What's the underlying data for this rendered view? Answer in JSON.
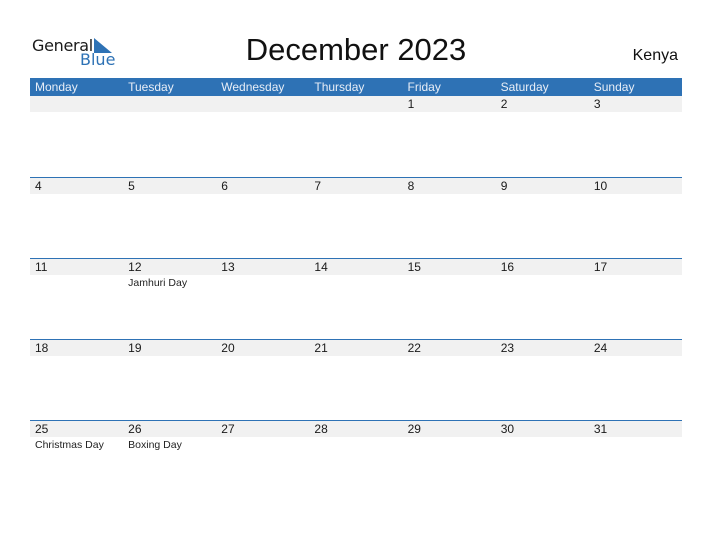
{
  "logo": {
    "general": "General",
    "blue": "Blue"
  },
  "title": "December 2023",
  "country": "Kenya",
  "colors": {
    "accent": "#2e72b5",
    "band": "#f1f1f1"
  },
  "days_of_week": [
    "Monday",
    "Tuesday",
    "Wednesday",
    "Thursday",
    "Friday",
    "Saturday",
    "Sunday"
  ],
  "weeks": [
    [
      {
        "day": "",
        "holiday": ""
      },
      {
        "day": "",
        "holiday": ""
      },
      {
        "day": "",
        "holiday": ""
      },
      {
        "day": "",
        "holiday": ""
      },
      {
        "day": "1",
        "holiday": ""
      },
      {
        "day": "2",
        "holiday": ""
      },
      {
        "day": "3",
        "holiday": ""
      }
    ],
    [
      {
        "day": "4",
        "holiday": ""
      },
      {
        "day": "5",
        "holiday": ""
      },
      {
        "day": "6",
        "holiday": ""
      },
      {
        "day": "7",
        "holiday": ""
      },
      {
        "day": "8",
        "holiday": ""
      },
      {
        "day": "9",
        "holiday": ""
      },
      {
        "day": "10",
        "holiday": ""
      }
    ],
    [
      {
        "day": "11",
        "holiday": ""
      },
      {
        "day": "12",
        "holiday": "Jamhuri Day"
      },
      {
        "day": "13",
        "holiday": ""
      },
      {
        "day": "14",
        "holiday": ""
      },
      {
        "day": "15",
        "holiday": ""
      },
      {
        "day": "16",
        "holiday": ""
      },
      {
        "day": "17",
        "holiday": ""
      }
    ],
    [
      {
        "day": "18",
        "holiday": ""
      },
      {
        "day": "19",
        "holiday": ""
      },
      {
        "day": "20",
        "holiday": ""
      },
      {
        "day": "21",
        "holiday": ""
      },
      {
        "day": "22",
        "holiday": ""
      },
      {
        "day": "23",
        "holiday": ""
      },
      {
        "day": "24",
        "holiday": ""
      }
    ],
    [
      {
        "day": "25",
        "holiday": "Christmas Day"
      },
      {
        "day": "26",
        "holiday": "Boxing Day"
      },
      {
        "day": "27",
        "holiday": ""
      },
      {
        "day": "28",
        "holiday": ""
      },
      {
        "day": "29",
        "holiday": ""
      },
      {
        "day": "30",
        "holiday": ""
      },
      {
        "day": "31",
        "holiday": ""
      }
    ]
  ]
}
